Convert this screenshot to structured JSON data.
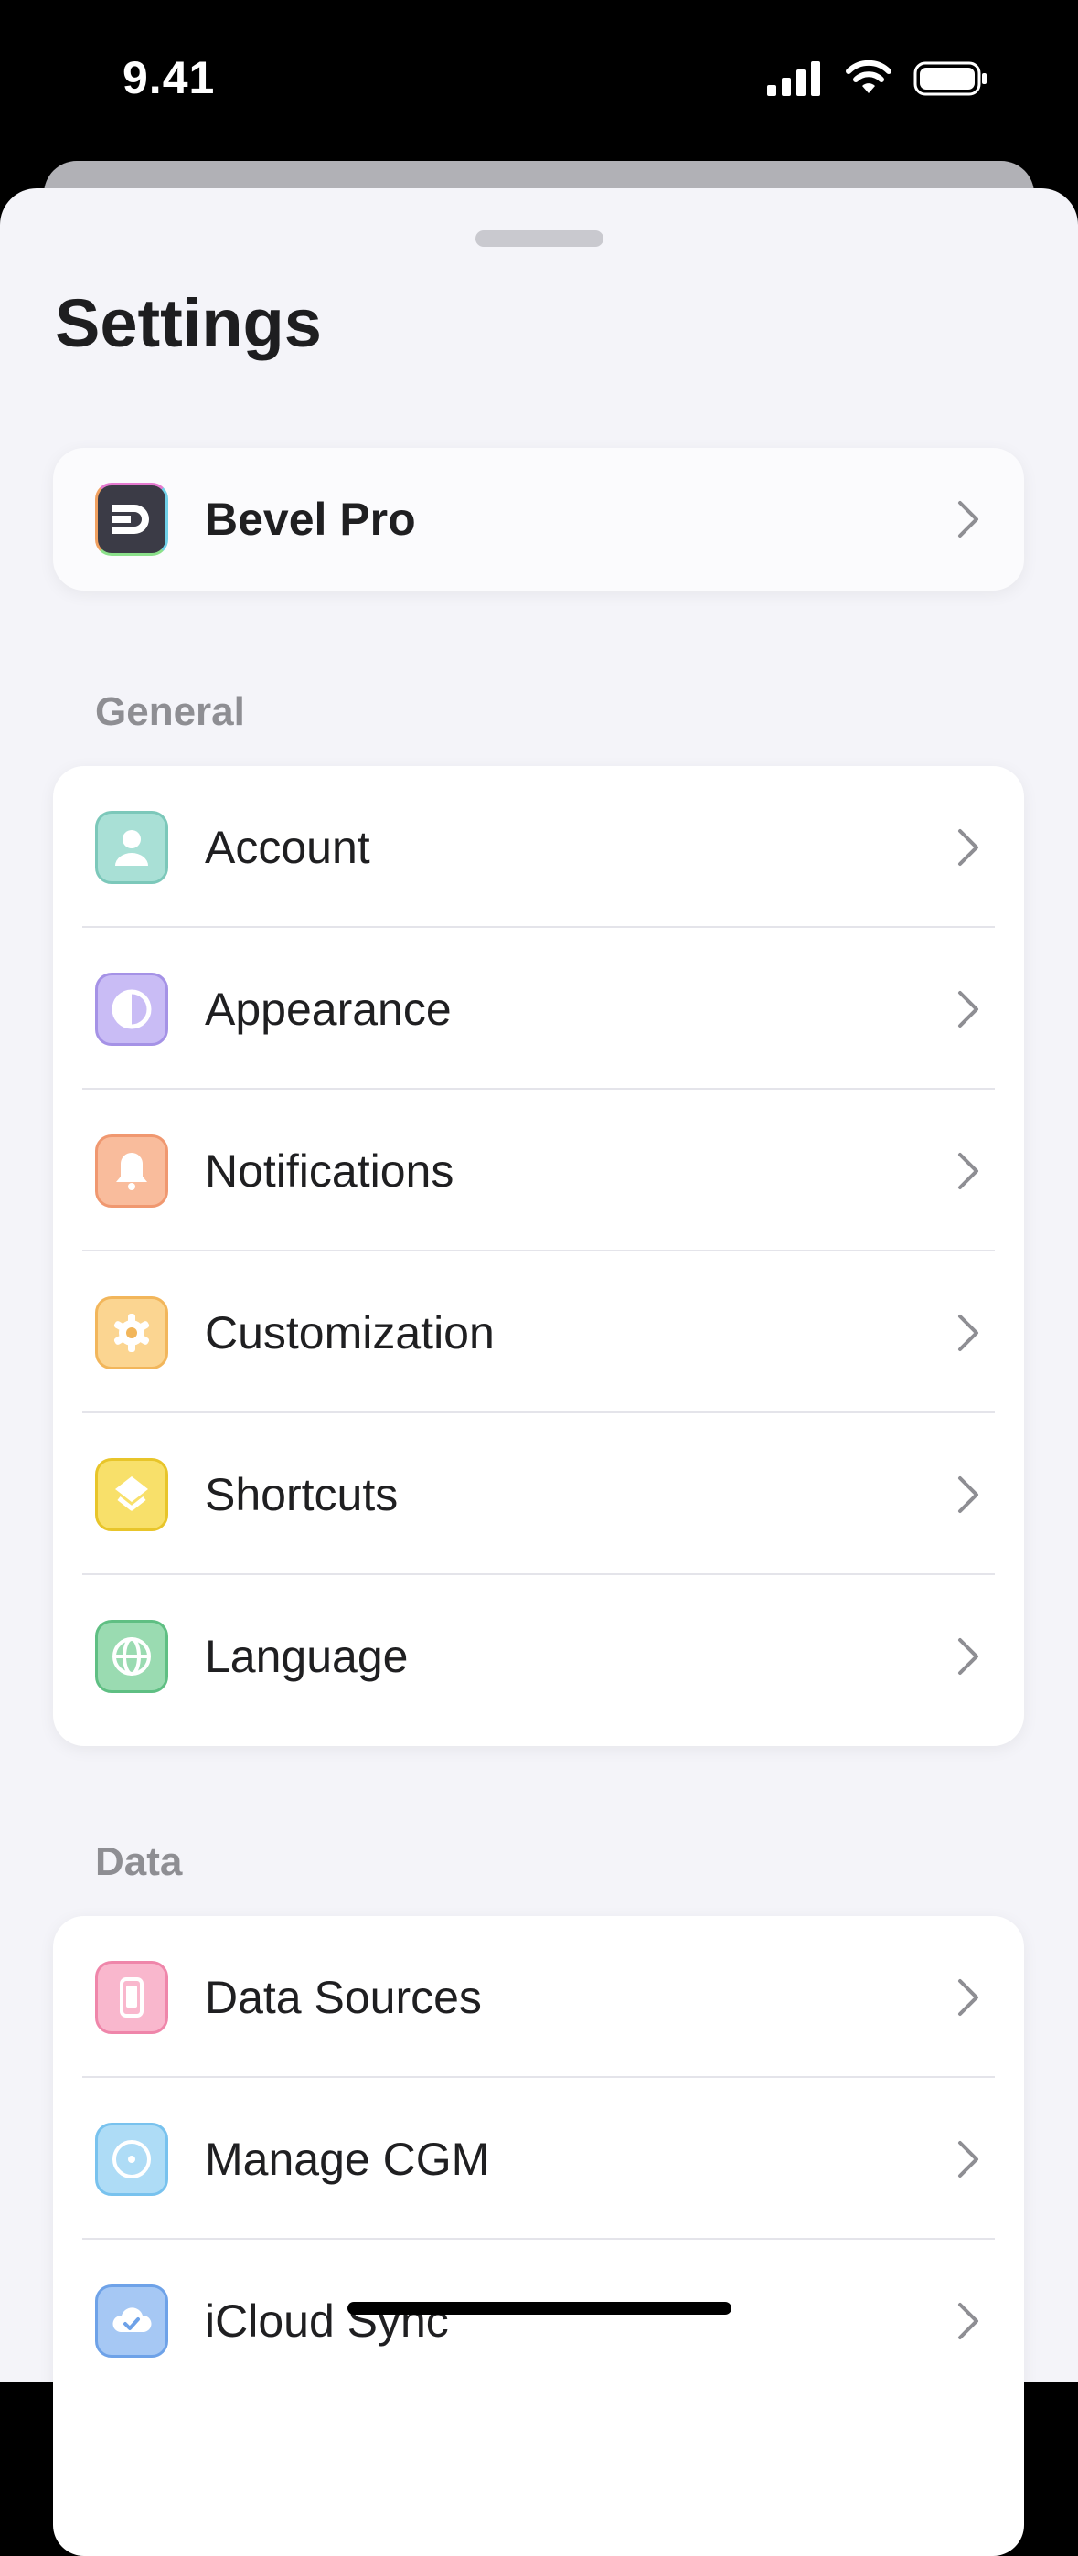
{
  "status_bar": {
    "time": "9.41"
  },
  "page": {
    "title": "Settings"
  },
  "pro": {
    "label": "Bevel Pro"
  },
  "sections": {
    "general": {
      "header": "General",
      "items": [
        {
          "label": "Account",
          "icon": "person-icon",
          "color": "#8fd3c7"
        },
        {
          "label": "Appearance",
          "icon": "half-circle-icon",
          "color": "#b8a6f0"
        },
        {
          "label": "Notifications",
          "icon": "bell-icon",
          "color": "#f6a882"
        },
        {
          "label": "Customization",
          "icon": "gear-icon",
          "color": "#f8c77a"
        },
        {
          "label": "Shortcuts",
          "icon": "layers-icon",
          "color": "#f5d54a"
        },
        {
          "label": "Language",
          "icon": "globe-icon",
          "color": "#7fcf9a"
        }
      ]
    },
    "data": {
      "header": "Data",
      "items": [
        {
          "label": "Data Sources",
          "icon": "phone-icon",
          "color": "#f59ab8"
        },
        {
          "label": "Manage CGM",
          "icon": "sensor-icon",
          "color": "#8fcdf2"
        },
        {
          "label": "iCloud Sync",
          "icon": "cloud-check-icon",
          "color": "#7fb1ee"
        }
      ]
    }
  }
}
